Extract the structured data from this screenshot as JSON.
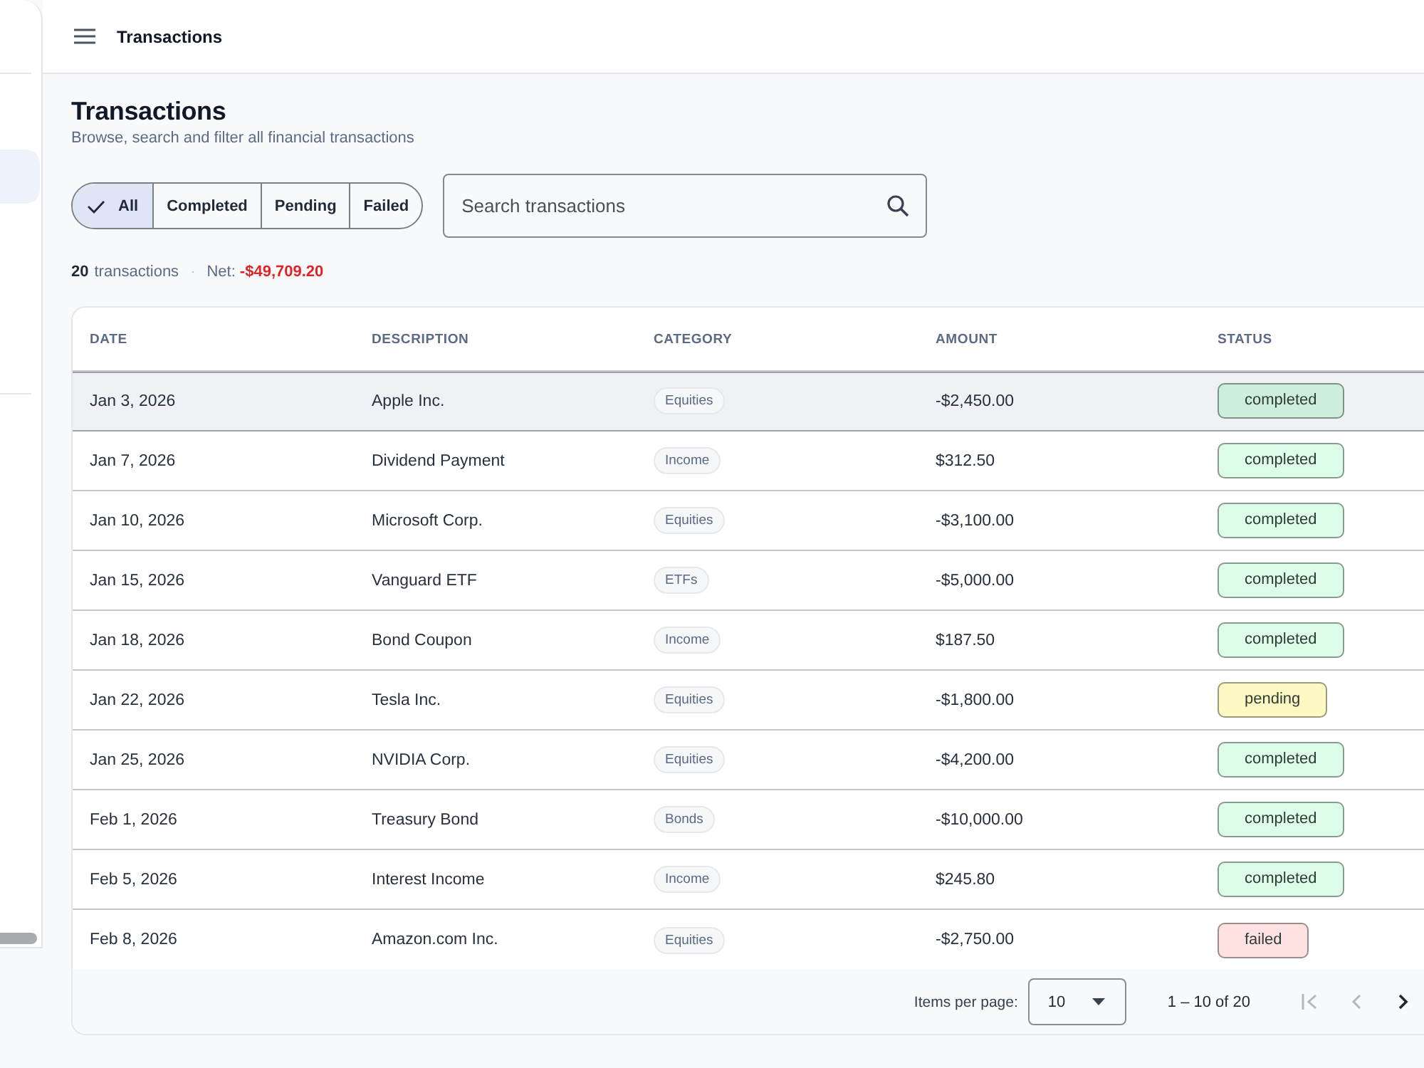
{
  "app_bar": {
    "title": "Transactions"
  },
  "page": {
    "title": "Transactions",
    "subtitle": "Browse, search and filter all financial transactions"
  },
  "filters": [
    {
      "label": "All",
      "selected": true
    },
    {
      "label": "Completed",
      "selected": false
    },
    {
      "label": "Pending",
      "selected": false
    },
    {
      "label": "Failed",
      "selected": false
    }
  ],
  "search": {
    "placeholder": "Search transactions"
  },
  "summary": {
    "count": "20",
    "count_label": "transactions",
    "separator": "·",
    "net_label": "Net:",
    "net_value": "-$49,709.20"
  },
  "table": {
    "columns": [
      "DATE",
      "DESCRIPTION",
      "CATEGORY",
      "AMOUNT",
      "STATUS"
    ],
    "rows": [
      {
        "date": "Jan 3, 2026",
        "description": "Apple Inc.",
        "category": "Equities",
        "amount": "-$2,450.00",
        "status": {
          "label": "completed",
          "color": "#cdeedb"
        },
        "selected": true
      },
      {
        "date": "Jan 7, 2026",
        "description": "Dividend Payment",
        "category": "Income",
        "amount": "$312.50",
        "status": {
          "label": "completed",
          "color": "#dcfce7"
        },
        "selected": false
      },
      {
        "date": "Jan 10, 2026",
        "description": "Microsoft Corp.",
        "category": "Equities",
        "amount": "-$3,100.00",
        "status": {
          "label": "completed",
          "color": "#dcfce7"
        },
        "selected": false
      },
      {
        "date": "Jan 15, 2026",
        "description": "Vanguard ETF",
        "category": "ETFs",
        "amount": "-$5,000.00",
        "status": {
          "label": "completed",
          "color": "#dcfce7"
        },
        "selected": false
      },
      {
        "date": "Jan 18, 2026",
        "description": "Bond Coupon",
        "category": "Income",
        "amount": "$187.50",
        "status": {
          "label": "completed",
          "color": "#dcfce7"
        },
        "selected": false
      },
      {
        "date": "Jan 22, 2026",
        "description": "Tesla Inc.",
        "category": "Equities",
        "amount": "-$1,800.00",
        "status": {
          "label": "pending",
          "color": "#fef9c3"
        },
        "selected": false
      },
      {
        "date": "Jan 25, 2026",
        "description": "NVIDIA Corp.",
        "category": "Equities",
        "amount": "-$4,200.00",
        "status": {
          "label": "completed",
          "color": "#dcfce7"
        },
        "selected": false
      },
      {
        "date": "Feb 1, 2026",
        "description": "Treasury Bond",
        "category": "Bonds",
        "amount": "-$10,000.00",
        "status": {
          "label": "completed",
          "color": "#dcfce7"
        },
        "selected": false
      },
      {
        "date": "Feb 5, 2026",
        "description": "Interest Income",
        "category": "Income",
        "amount": "$245.80",
        "status": {
          "label": "completed",
          "color": "#dcfce7"
        },
        "selected": false
      },
      {
        "date": "Feb 8, 2026",
        "description": "Amazon.com Inc.",
        "category": "Equities",
        "amount": "-$2,750.00",
        "status": {
          "label": "failed",
          "color": "#fee2e2"
        },
        "selected": false
      }
    ]
  },
  "paginator": {
    "label": "Items per page:",
    "page_size": "10",
    "range": "1 – 10 of 20",
    "buttons": [
      {
        "kind": "first",
        "disabled": true
      },
      {
        "kind": "previous",
        "disabled": true
      },
      {
        "kind": "next",
        "disabled": false
      }
    ]
  }
}
